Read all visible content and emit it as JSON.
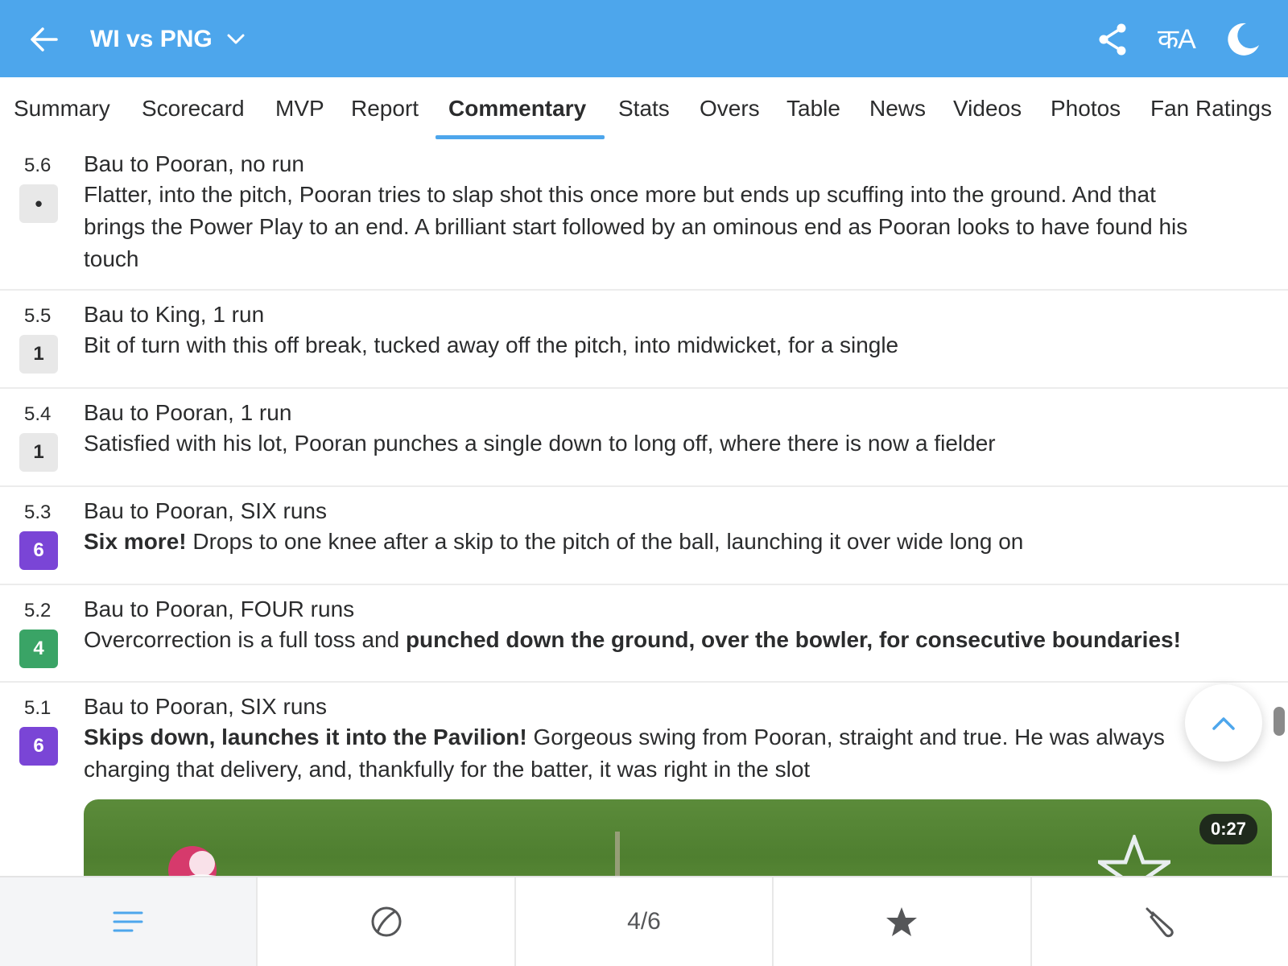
{
  "header": {
    "title": "WI vs PNG",
    "lang_label": "कA"
  },
  "tabs": [
    {
      "label": "Summary"
    },
    {
      "label": "Scorecard"
    },
    {
      "label": "MVP"
    },
    {
      "label": "Report"
    },
    {
      "label": "Commentary",
      "active": true
    },
    {
      "label": "Stats"
    },
    {
      "label": "Overs"
    },
    {
      "label": "Table"
    },
    {
      "label": "News"
    },
    {
      "label": "Videos"
    },
    {
      "label": "Photos"
    },
    {
      "label": "Fan Ratings"
    }
  ],
  "commentary": [
    {
      "over": "5.6",
      "badge": "•",
      "headline": "Bau to Pooran, no run",
      "desc_line1": "Flatter, into the pitch, Pooran tries to slap shot this once more but ends up scuffing into the ground. And that",
      "desc_line2": "brings the Power Play to an end. A brilliant start followed by an ominous end as Pooran looks to have found his",
      "desc_line3": "touch"
    },
    {
      "over": "5.5",
      "badge": "1",
      "headline": "Bau to King, 1 run",
      "desc": "Bit of turn with this off break, tucked away off the pitch, into midwicket, for a single"
    },
    {
      "over": "5.4",
      "badge": "1",
      "headline": "Bau to Pooran, 1 run",
      "desc": "Satisfied with his lot, Pooran punches a single down to long off, where there is now a fielder"
    },
    {
      "over": "5.3",
      "badge": "6",
      "headline": "Bau to Pooran, SIX runs",
      "desc_bold": "Six more!",
      "desc_rest": " Drops to one knee after a skip to the pitch of the ball, launching it over wide long on"
    },
    {
      "over": "5.2",
      "badge": "4",
      "headline": "Bau to Pooran, FOUR runs",
      "desc_plain": "Overcorrection is a full toss and ",
      "desc_bold": "punched down the ground, over the bowler, for consecutive boundaries!"
    },
    {
      "over": "5.1",
      "badge": "6",
      "headline": "Bau to Pooran, SIX runs",
      "desc_bold": "Skips down, launches it into the Pavilion!",
      "desc_rest": " Gorgeous swing from Pooran, straight and true. He was always",
      "desc_line2": "charging that delivery, and, thankfully for the batter, it was right in the slot",
      "video_duration": "0:27"
    }
  ],
  "bottom_nav": {
    "page_indicator": "4/6"
  },
  "colors": {
    "header_bg": "#4da6ec",
    "accent": "#4da6ec",
    "six_badge": "#7a45d6",
    "four_badge": "#3aa466",
    "neutral_badge": "#e8e8e8"
  }
}
